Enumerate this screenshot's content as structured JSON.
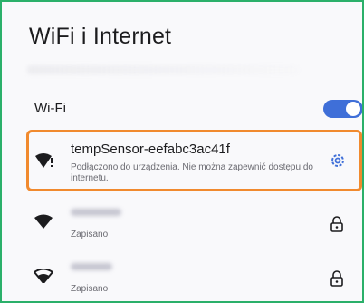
{
  "header": {
    "title": "WiFi i Internet"
  },
  "wifi": {
    "label": "Wi-Fi",
    "enabled": true,
    "toggle_color": "#3f6fd8"
  },
  "highlight_color": "#f18a2e",
  "networks": [
    {
      "name": "tempSensor-eefabc3ac41f",
      "status": "Podłączono do urządzenia. Nie można zapewnić dostępu do internetu.",
      "icon": "wifi-no-internet-icon",
      "action_icon": "gear-icon"
    },
    {
      "status": "Zapisano",
      "icon": "wifi-signal-icon",
      "action_icon": "lock-icon"
    },
    {
      "status": "Zapisano",
      "icon": "wifi-signal-icon",
      "action_icon": "lock-icon"
    }
  ]
}
